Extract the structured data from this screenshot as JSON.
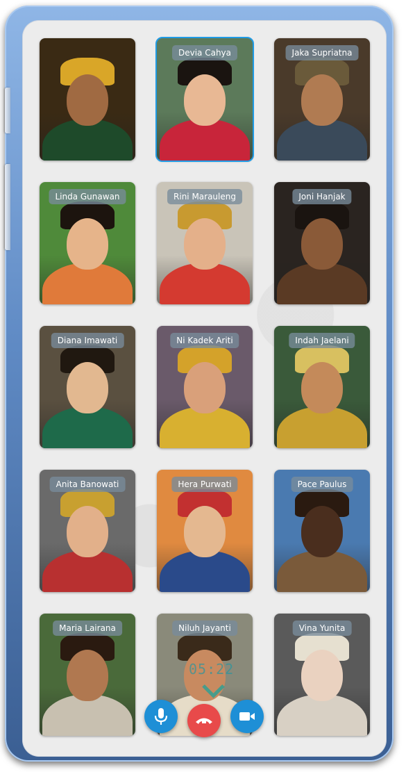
{
  "call": {
    "timer": "05:22",
    "participants": [
      {
        "name": "",
        "colors": {
          "bg": "#3a2a14",
          "skin": "#a06a42",
          "head": "#d9a628",
          "body": "#1e4a2a"
        }
      },
      {
        "name": "Devia Cahya",
        "colors": {
          "bg": "#5c7a5a",
          "skin": "#e8b894",
          "head": "#1a1410",
          "body": "#c8253a"
        }
      },
      {
        "name": "Jaka Supriatna",
        "colors": {
          "bg": "#4a3a2a",
          "skin": "#b07b52",
          "head": "#6a5a3a",
          "body": "#3a4a5a"
        }
      },
      {
        "name": "Linda Gunawan",
        "colors": {
          "bg": "#4f8a3a",
          "skin": "#e6b48a",
          "head": "#1c140e",
          "body": "#e07a3a"
        }
      },
      {
        "name": "Rini Marauleng",
        "colors": {
          "bg": "#c9c4b8",
          "skin": "#e4b08a",
          "head": "#c89a30",
          "body": "#d43a30"
        }
      },
      {
        "name": "Joni Hanjak",
        "colors": {
          "bg": "#2a2420",
          "skin": "#8a5a38",
          "head": "#1a1410",
          "body": "#5a3a24"
        }
      },
      {
        "name": "Diana Imawati",
        "colors": {
          "bg": "#5a5040",
          "skin": "#e2b890",
          "head": "#201810",
          "body": "#1e6a4a"
        }
      },
      {
        "name": "Ni Kadek Ariti",
        "colors": {
          "bg": "#6a5a6a",
          "skin": "#d9a07a",
          "head": "#d4a22a",
          "body": "#d8b030"
        }
      },
      {
        "name": "Indah Jaelani",
        "colors": {
          "bg": "#3a5a3a",
          "skin": "#c48a5a",
          "head": "#d8c060",
          "body": "#c8a030"
        }
      },
      {
        "name": "Anita Banowati",
        "colors": {
          "bg": "#6a6a6a",
          "skin": "#e2b08a",
          "head": "#c8a030",
          "body": "#b83030"
        }
      },
      {
        "name": "Hera Purwati",
        "colors": {
          "bg": "#e08a40",
          "skin": "#e4b890",
          "head": "#c23030",
          "body": "#2a4a8a"
        }
      },
      {
        "name": "Pace Paulus",
        "colors": {
          "bg": "#4a7ab0",
          "skin": "#4a2e1e",
          "head": "#2a1a10",
          "body": "#7a5a3a"
        }
      },
      {
        "name": "Maria Lairana",
        "colors": {
          "bg": "#4a6a3a",
          "skin": "#b07850",
          "head": "#2a1a10",
          "body": "#c8c0b0"
        }
      },
      {
        "name": "Niluh Jayanti",
        "colors": {
          "bg": "#8a8a7a",
          "skin": "#c88a60",
          "head": "#3a2a1a",
          "body": "#e6dcc8"
        }
      },
      {
        "name": "Vina Yunita",
        "colors": {
          "bg": "#5a5a5a",
          "skin": "#ead2c0",
          "head": "#e6e0d0",
          "body": "#d8d0c4"
        }
      }
    ]
  },
  "controls": {
    "mic_color": "#1e8fd6",
    "end_color": "#e84a4a",
    "video_color": "#1e8fd6"
  }
}
